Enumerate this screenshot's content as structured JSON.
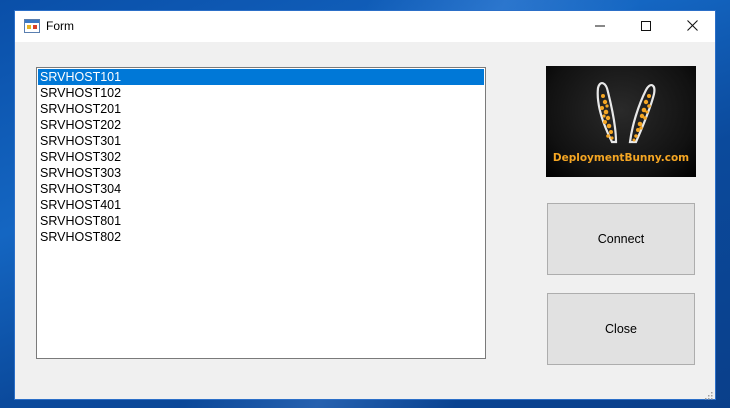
{
  "window": {
    "title": "Form"
  },
  "titlebar": {
    "minimize_icon": "minimize-icon",
    "maximize_icon": "maximize-icon",
    "close_icon": "close-icon"
  },
  "server_list": {
    "items": [
      {
        "label": "SRVHOST101",
        "selected": true
      },
      {
        "label": "SRVHOST102",
        "selected": false
      },
      {
        "label": "SRVHOST201",
        "selected": false
      },
      {
        "label": "SRVHOST202",
        "selected": false
      },
      {
        "label": "SRVHOST301",
        "selected": false
      },
      {
        "label": "SRVHOST302",
        "selected": false
      },
      {
        "label": "SRVHOST303",
        "selected": false
      },
      {
        "label": "SRVHOST304",
        "selected": false
      },
      {
        "label": "SRVHOST401",
        "selected": false
      },
      {
        "label": "SRVHOST801",
        "selected": false
      },
      {
        "label": "SRVHOST802",
        "selected": false
      }
    ]
  },
  "logo": {
    "text": "DeploymentBunny.com"
  },
  "buttons": {
    "connect_label": "Connect",
    "close_label": "Close"
  },
  "colors": {
    "selection": "#0078d7",
    "logo_accent": "#f5a623"
  }
}
